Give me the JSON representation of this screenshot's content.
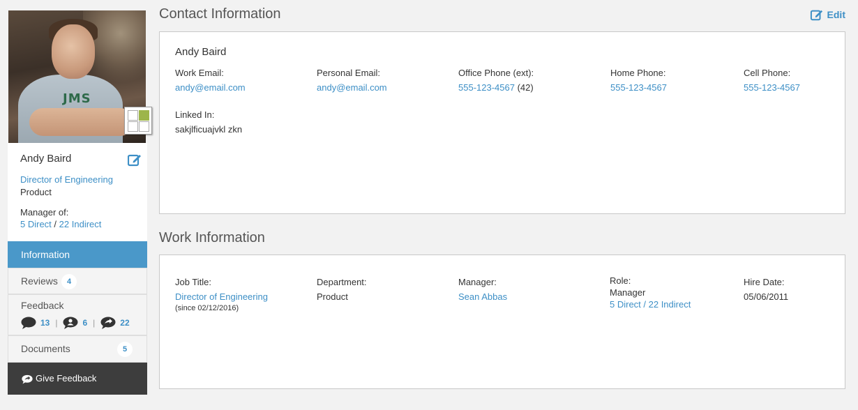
{
  "profile": {
    "name": "Andy Baird",
    "title": "Director of Engineering",
    "department": "Product",
    "manager_of_label": "Manager of:",
    "direct_link": "5 Direct",
    "indirect_link": "22 Indirect",
    "separator": "/"
  },
  "nav": {
    "information": "Information",
    "reviews": "Reviews",
    "reviews_count": "4",
    "feedback": "Feedback",
    "feedback_received": "13",
    "feedback_private": "6",
    "feedback_given": "22",
    "documents": "Documents",
    "documents_count": "5",
    "give_feedback": "Give Feedback"
  },
  "contact": {
    "section_title": "Contact Information",
    "edit_label": "Edit",
    "name": "Andy Baird",
    "work_email_label": "Work Email:",
    "work_email": "andy@email.com",
    "personal_email_label": "Personal Email:",
    "personal_email": "andy@email.com",
    "office_phone_label": "Office Phone (ext):",
    "office_phone": "555-123-4567",
    "office_ext": "(42)",
    "home_phone_label": "Home Phone:",
    "home_phone": "555-123-4567",
    "cell_phone_label": "Cell Phone:",
    "cell_phone": "555-123-4567",
    "linkedin_label": "Linked In:",
    "linkedin": "sakjlficuajvkl zkn"
  },
  "work": {
    "section_title": "Work Information",
    "job_title_label": "Job Title:",
    "job_title": "Director of Engineering",
    "job_since": "(since 02/12/2016)",
    "department_label": "Department:",
    "department": "Product",
    "manager_label": "Manager:",
    "manager": "Sean Abbas",
    "role_label": "Role:",
    "role": "Manager",
    "role_reports": "5 Direct / 22 Indirect",
    "hire_date_label": "Hire Date:",
    "hire_date": "05/06/2011"
  },
  "colors": {
    "accent": "#3d8fc6",
    "nav_active": "#4a98c9",
    "button_dark": "#3d3d3d",
    "badge_green": "#9db54a"
  }
}
